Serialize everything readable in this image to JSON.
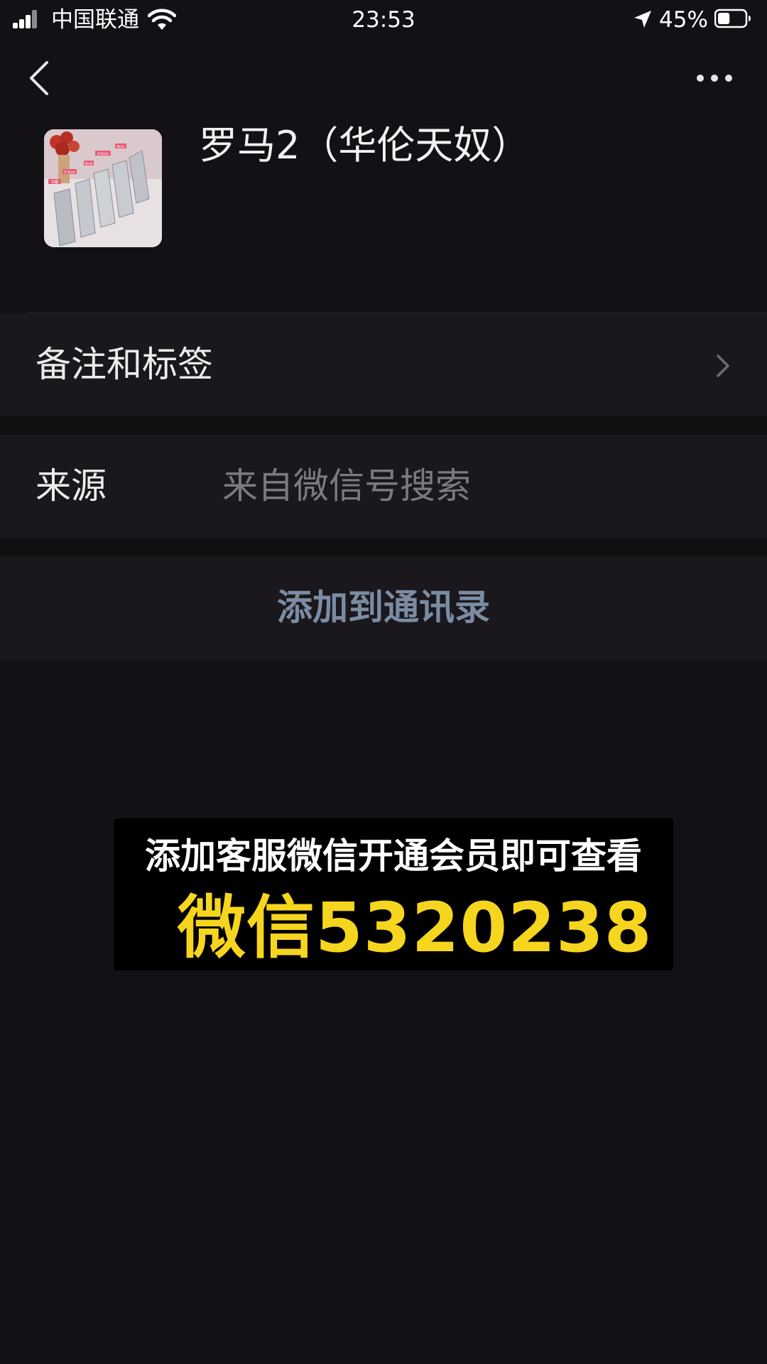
{
  "status_bar": {
    "carrier": "中国联通",
    "time": "23:53",
    "battery_percent": "45%",
    "battery_level": 0.45,
    "signal_icon": "cellular-signal-icon",
    "wifi_icon": "wifi-icon",
    "location_icon": "location-arrow-icon",
    "battery_icon": "battery-icon"
  },
  "nav": {
    "back_icon": "chevron-left-icon",
    "more_icon": "more-horizontal-icon"
  },
  "profile": {
    "name": "罗马2（华伦天奴）",
    "avatar_image": "shoes-photo",
    "avatar_labels": [
      "8cm",
      "4.5cm",
      "6cm",
      "4.5cm",
      "平跟"
    ]
  },
  "rows": {
    "remarks_label": "备注和标签",
    "source_label": "来源",
    "source_value": "来自微信号搜索",
    "add_contact_label": "添加到通讯录"
  },
  "promo": {
    "line1": "添加客服微信开通会员即可查看",
    "line2": "微信5320238"
  },
  "colors": {
    "background": "#141116",
    "row_background": "#1b181d",
    "accent_link": "#7b8ca3",
    "promo_yellow": "#f6d51e"
  }
}
